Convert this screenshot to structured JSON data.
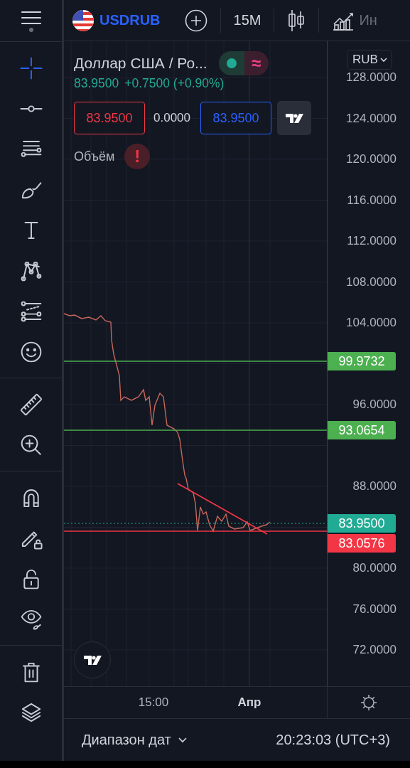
{
  "toolbar": {
    "groups": [
      {
        "tools": [
          {
            "kind": "crosshair",
            "selected": true
          },
          {
            "kind": "trend-line",
            "selected": false
          },
          {
            "kind": "parallel-lines",
            "selected": false
          },
          {
            "kind": "brush",
            "selected": false
          },
          {
            "kind": "text",
            "selected": false
          },
          {
            "kind": "pattern",
            "selected": false
          },
          {
            "kind": "dotted-lines",
            "selected": false
          },
          {
            "kind": "smiley",
            "selected": false
          }
        ]
      },
      {
        "tools": [
          {
            "kind": "ruler",
            "selected": false
          },
          {
            "kind": "zoom-in",
            "selected": false
          }
        ]
      },
      {
        "tools": [
          {
            "kind": "magnet",
            "selected": false
          },
          {
            "kind": "pencil-lock",
            "selected": false
          },
          {
            "kind": "lock",
            "selected": false
          },
          {
            "kind": "eye",
            "selected": false
          }
        ]
      },
      {
        "tools": [
          {
            "kind": "trash",
            "selected": false
          },
          {
            "kind": "layers",
            "selected": false
          }
        ]
      }
    ]
  },
  "topbar": {
    "symbol": "USDRUB",
    "interval": "15M",
    "indicators": "Ин"
  },
  "legend": {
    "title": "Доллар США / Ро...",
    "status_icon": "≈",
    "price": "83.9500",
    "change": "+0.7500 (+0.90%)",
    "sell": "83.9500",
    "spread": "0.0000",
    "buy": "83.9500",
    "volume_label": "Объём",
    "volume_alert": "!"
  },
  "price_axis": {
    "currency": "RUB",
    "ticks": [
      "128.0000",
      "124.0000",
      "120.0000",
      "116.0000",
      "112.0000",
      "108.0000",
      "104.0000",
      "96.0000",
      "88.0000",
      "80.0000",
      "76.0000",
      "72.0000"
    ],
    "lines": [
      {
        "label": "99.9732",
        "color": "#4caf50",
        "kind": "level"
      },
      {
        "label": "93.0654",
        "color": "#4caf50",
        "kind": "level"
      },
      {
        "label": "83.9500",
        "color": "#22ab94",
        "kind": "last-price"
      },
      {
        "label": "83.0576",
        "color": "#f23645",
        "kind": "level"
      }
    ]
  },
  "time_axis": {
    "labels": [
      {
        "label": "15:00",
        "emphasized": false
      },
      {
        "label": "Апр",
        "emphasized": true
      }
    ]
  },
  "footer": {
    "date_range": "Диапазон дат",
    "time": "20:23:03 (UTC+3)"
  }
}
